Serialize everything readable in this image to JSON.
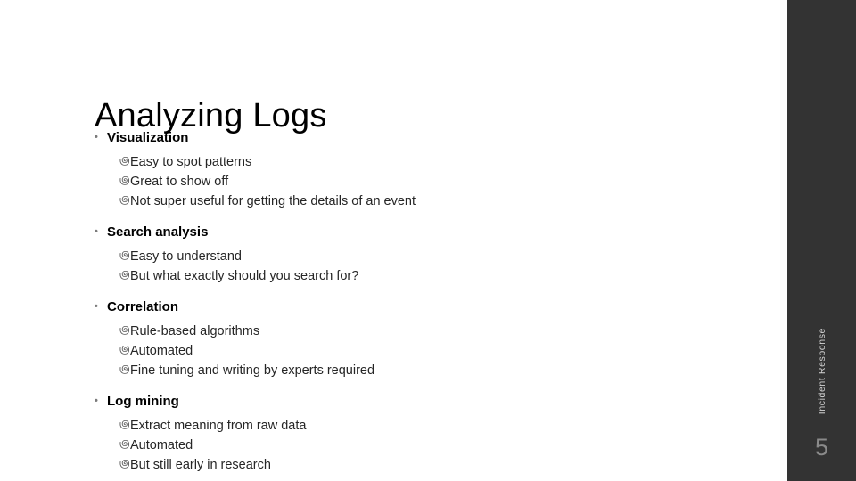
{
  "slide": {
    "title": "Analyzing Logs",
    "level1_bullet_glyph": "•",
    "level2_bullet_glyph": "಄",
    "groups": [
      {
        "heading": "Visualization",
        "items": [
          "Easy to spot patterns",
          "Great to show off",
          "Not super useful for getting the details of an event"
        ]
      },
      {
        "heading": "Search analysis",
        "items": [
          "Easy to understand",
          "But what exactly should you search for?"
        ]
      },
      {
        "heading": "Correlation",
        "items": [
          "Rule-based algorithms",
          "Automated",
          "Fine tuning and writing by experts required"
        ]
      },
      {
        "heading": "Log mining",
        "items": [
          "Extract meaning from raw data",
          "Automated",
          "But still early in research"
        ]
      }
    ]
  },
  "sidebar": {
    "section_label": "Incident Response",
    "page_number": "5",
    "background_color": "#333333",
    "label_color": "#d4d4d4",
    "page_number_color": "#8a8a8a"
  }
}
